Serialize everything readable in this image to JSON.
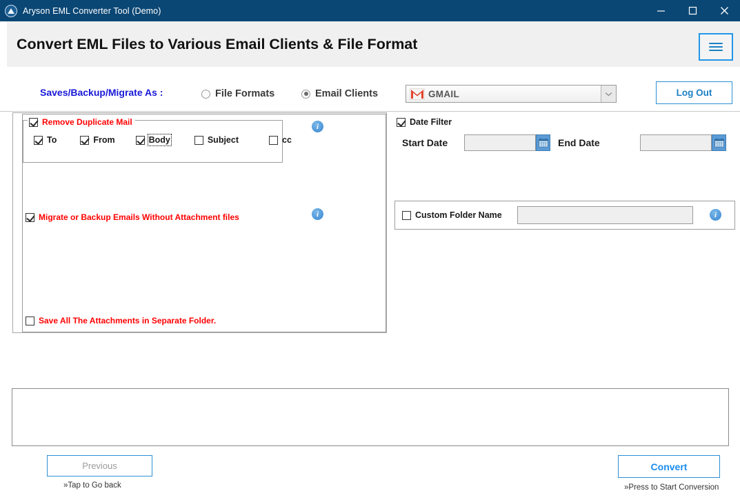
{
  "window": {
    "title": "Aryson EML Converter Tool (Demo)",
    "app_icon": "aryson-logo-icon",
    "controls": {
      "minimize": "minimize-icon",
      "maximize": "maximize-icon",
      "close": "close-icon"
    },
    "titlebar_color": "#0b4775"
  },
  "header": {
    "heading": "Convert EML Files to Various Email Clients & File Format",
    "menu_icon": "hamburger-menu-icon",
    "accent_color": "#2196e8"
  },
  "options_bar": {
    "saves_label": "Saves/Backup/Migrate As :",
    "saves_label_color": "#1818d8",
    "radios": [
      {
        "label": "File Formats",
        "selected": false
      },
      {
        "label": "Email Clients",
        "selected": true
      }
    ],
    "client_select": {
      "value": "GMAIL",
      "icon": "gmail-logo-icon",
      "arrow": "chevron-down-icon"
    },
    "logout_label": "Log Out"
  },
  "left_panel": {
    "duplicate_group": {
      "label": "Remove Duplicate Mail",
      "checked": true,
      "color": "#ff0000",
      "items": [
        {
          "label": "To",
          "checked": true,
          "focused": false
        },
        {
          "label": "From",
          "checked": true,
          "focused": false
        },
        {
          "label": "Body",
          "checked": true,
          "focused": true
        },
        {
          "label": "Subject",
          "checked": false,
          "focused": false
        },
        {
          "label": "cc",
          "checked": false,
          "focused": false
        }
      ]
    },
    "migrate_option": {
      "label": "Migrate or Backup Emails Without Attachment files",
      "checked": true,
      "color": "#ff0000"
    },
    "save_attachments_option": {
      "label": "Save All The Attachments in Separate Folder.",
      "checked": false,
      "color": "#ff0000"
    },
    "info_icons": [
      "info-icon",
      "info-icon"
    ]
  },
  "right_panel": {
    "date_filter": {
      "label": "Date Filter",
      "checked": true,
      "start": {
        "label": "Start Date",
        "value": "",
        "calendar_icon": "calendar-icon"
      },
      "end": {
        "label": "End Date",
        "value": "",
        "calendar_icon": "calendar-icon"
      }
    },
    "custom_folder": {
      "label": "Custom Folder Name",
      "checked": false,
      "value": "",
      "info_icon": "info-icon"
    }
  },
  "log_area": {
    "content": ""
  },
  "footer": {
    "previous": {
      "label": "Previous",
      "hint": "»Tap to Go back",
      "disabled": true
    },
    "convert": {
      "label": "Convert",
      "hint": "»Press to Start Conversion",
      "disabled": false
    }
  }
}
